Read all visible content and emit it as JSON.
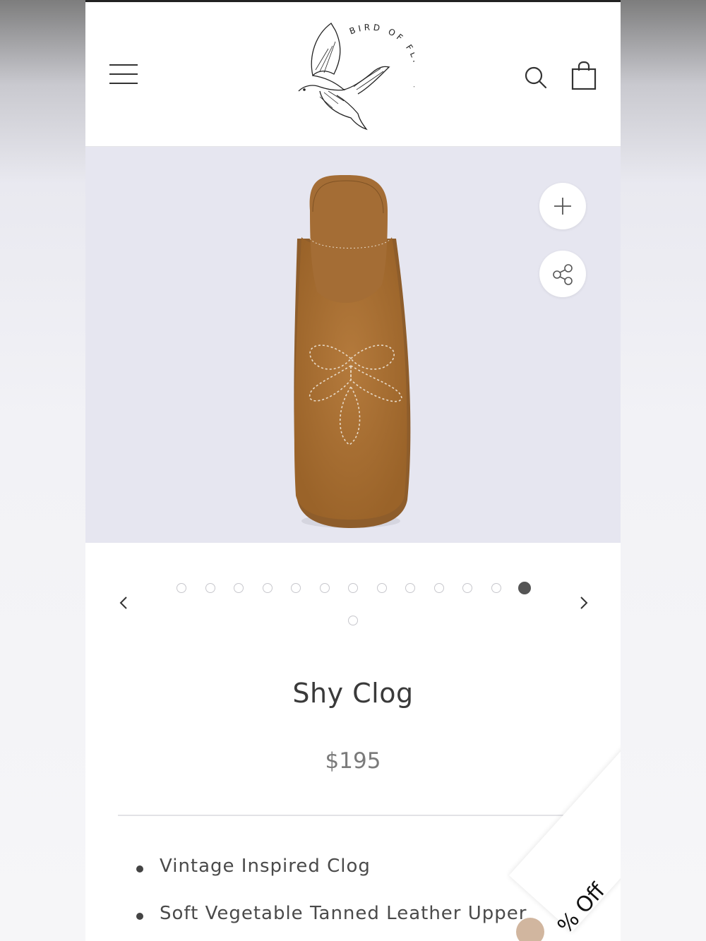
{
  "header": {
    "logo_text": "BIRD OF FLIGHT",
    "icons": [
      "menu-icon",
      "search-icon",
      "shopping-bag-icon"
    ]
  },
  "gallery": {
    "icons": [
      "plus-icon",
      "share-icon"
    ],
    "slide_count": 14,
    "active_slide": 13,
    "prev_icon": "chevron-left-icon",
    "next_icon": "chevron-right-icon"
  },
  "product": {
    "title": "Shy Clog",
    "price": "$195",
    "features": [
      "Vintage Inspired Clog",
      "Soft Vegetable Tanned Leather Upper"
    ]
  },
  "promo": {
    "label": "% Off"
  },
  "colors": {
    "background": "#ffffff",
    "gallery_bg": "#e6e6f0",
    "suede": "#a86f33",
    "text": "#3a3a3a",
    "price": "#7a7a7a"
  }
}
